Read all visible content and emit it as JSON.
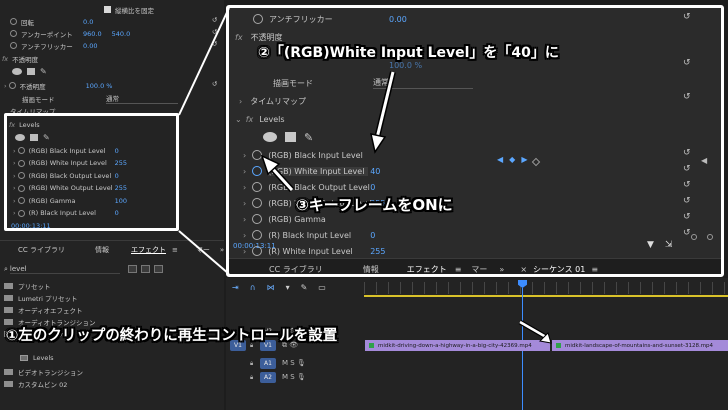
{
  "ec_top": {
    "uniform_scale": "縦横比を固定",
    "rotation": "回転",
    "rotation_value": "0.0",
    "anchor": "アンカーポイント",
    "anchor_x": "960.0",
    "anchor_y": "540.0",
    "antiflicker": "アンチフリッカー",
    "antiflicker_value": "0.00",
    "opacity_header": "不透明度",
    "opacity": "不透明度",
    "opacity_value": "100.0 %",
    "blend_mode": "描画モード",
    "blend_value": "通常",
    "time_remap": "タイムリマップ"
  },
  "small_levels": {
    "header": "Levels",
    "params": [
      {
        "label": "(RGB) Black Input Level",
        "value": "0"
      },
      {
        "label": "(RGB) White Input Level",
        "value": "255"
      },
      {
        "label": "(RGB) Black Output Level",
        "value": "0"
      },
      {
        "label": "(RGB) White Output Level",
        "value": "255"
      },
      {
        "label": "(RGB) Gamma",
        "value": "100"
      },
      {
        "label": "(R) Black Input Level",
        "value": "0"
      }
    ],
    "timecode": "00:00:13:11"
  },
  "zoom": {
    "antiflicker": "アンチフリッカー",
    "antiflicker_value": "0.00",
    "opacity_header": "不透明度",
    "opacity_value": "100.0 %",
    "blend_mode": "描画モード",
    "blend_value": "通常",
    "time_remap": "タイムリマップ",
    "levels_header": "Levels",
    "params": [
      {
        "label": "(RGB) Black Input Level",
        "value": ""
      },
      {
        "label": "(RGB) White Input Level",
        "value": "40"
      },
      {
        "label": "(RGB) Black Output Level",
        "value": "0"
      },
      {
        "label": "(RGB) White Output Level",
        "value": "255"
      },
      {
        "label": "(RGB) Gamma",
        "value": ""
      },
      {
        "label": "(R) Black Input Level",
        "value": "0"
      },
      {
        "label": "(R) White Input Level",
        "value": "255"
      }
    ],
    "timecode": "00:00:13:11",
    "tabs": [
      "CC ライブラリ",
      "情報",
      "エフェクト",
      "マー",
      "シーケンス 01"
    ]
  },
  "effects_panel": {
    "tabs": [
      "CC ライブラリ",
      "情報",
      "エフェクト",
      "マー"
    ],
    "search_value": "level",
    "folders": [
      "プリセット",
      "Lumetri プリセット",
      "オーディオエフェクト",
      "オーディオトランジション",
      "ビデオエフェクト"
    ],
    "effect_item": "Levels",
    "folders_after": [
      "ビデオトランジション",
      "カスタムビン 02"
    ]
  },
  "timeline": {
    "tracks": [
      "V2",
      "V1",
      "A1",
      "A2"
    ],
    "source_track": "V1",
    "clips": [
      {
        "name": "midkit-driving-down-a-highway-in-a-big-city-42369.mp4"
      },
      {
        "name": "midkit-landscape-of-mountains-and-sunset-3128.mp4"
      }
    ]
  },
  "callouts": {
    "step1": "①左のクリップの終わりに再生コントロールを設置",
    "step2": "②「(RGB)White Input Level」を「40」に",
    "step3": "③キーフレームをONに"
  },
  "colors": {
    "accent_blue": "#5ba7ff",
    "clip_purple": "#a48ad9",
    "panel_bg": "#232323",
    "callout_border": "#ffffff"
  }
}
